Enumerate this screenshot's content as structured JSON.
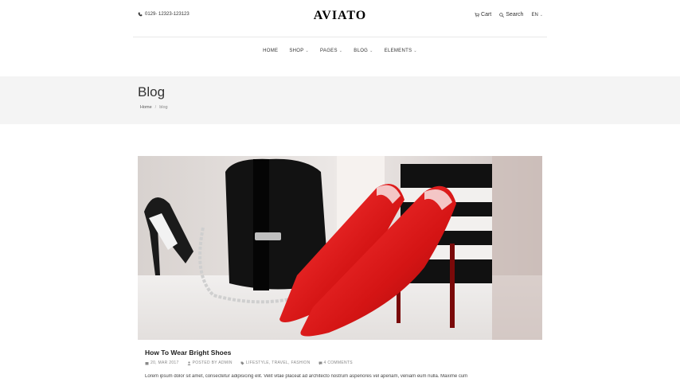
{
  "header": {
    "phone": "0129- 12323-123123",
    "logo": "AVIATO",
    "cart_label": "Cart",
    "search_label": "Search",
    "language": "EN"
  },
  "nav": {
    "items": [
      {
        "label": "HOME",
        "has_dropdown": false
      },
      {
        "label": "SHOP",
        "has_dropdown": true
      },
      {
        "label": "PAGES",
        "has_dropdown": true
      },
      {
        "label": "BLOG",
        "has_dropdown": true
      },
      {
        "label": "ELEMENTS",
        "has_dropdown": true
      }
    ]
  },
  "banner": {
    "title": "Blog",
    "breadcrumb": {
      "home": "Home",
      "separator": "/",
      "current": "blog"
    }
  },
  "post": {
    "title": "How To Wear Bright Shoes",
    "date": "20, MAR 2017",
    "author": "POSTED BY ADMIN",
    "categories": "LIFESTYLE, TRAVEL, FASHION",
    "comments": "4 COMMENTS",
    "excerpt": "Lorem ipsum dolor sit amet, consectetur adipisicing elit. Velit vitae placeat ad architecto nostrum asperiores vel aperiam, veniam eum nulla. Maxime cum"
  },
  "colors": {
    "banner_bg": "#f4f4f4",
    "accent_red": "#d81b1b",
    "text": "#222222"
  }
}
